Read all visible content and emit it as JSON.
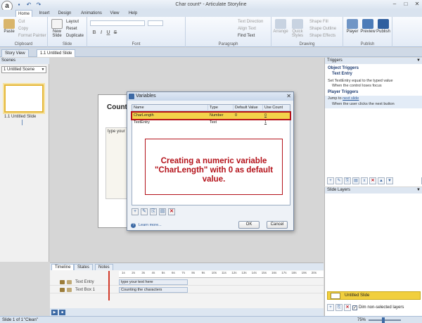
{
  "app": {
    "logo_letter": "a",
    "window_title": "Char count* - Articulate Storyline",
    "qat": [
      "save-icon",
      "undo-icon",
      "redo-icon"
    ]
  },
  "ribbon": {
    "tabs": [
      "Home",
      "Insert",
      "Design",
      "Animations",
      "View",
      "Help"
    ],
    "active_tab": "Home",
    "clipboard": {
      "label": "Clipboard",
      "paste": "Paste",
      "cut": "Cut",
      "copy": "Copy",
      "format_painter": "Format Painter"
    },
    "slide": {
      "label": "Slide",
      "new_slide": "New Slide",
      "layout": "Layout",
      "reset": "Reset",
      "duplicate": "Duplicate"
    },
    "font": {
      "label": "Font",
      "bold": "B",
      "italic": "I",
      "underline": "U",
      "strikethrough": "S"
    },
    "paragraph": {
      "label": "Paragraph",
      "text_direction": "Text Direction",
      "align_text": "Align Text",
      "find_text": "Find Text"
    },
    "drawing": {
      "label": "Drawing",
      "arrange": "Arrange",
      "quick_styles": "Quick Styles",
      "shape_fill": "Shape Fill",
      "shape_outline": "Shape Outline",
      "shape_effects": "Shape Effects"
    },
    "publish": {
      "label": "Publish",
      "player": "Player",
      "preview": "Preview",
      "publish": "Publish"
    }
  },
  "doc_tabs": [
    "Story View",
    "1.1 Untitled Slide"
  ],
  "scenes": {
    "header": "Scenes",
    "selected": "1 Untitled Scene",
    "slide_label": "1.1 Untitled Slide"
  },
  "stage": {
    "title": "Counting",
    "textbox": "type your"
  },
  "variables_dialog": {
    "title": "Variables",
    "columns": [
      "Name",
      "Type",
      "Default Value",
      "Use Count"
    ],
    "rows": [
      {
        "name": "CharLength",
        "type": "Number",
        "default": "0",
        "use_count": "0"
      },
      {
        "name": "TextEntry",
        "type": "Text",
        "default": "",
        "use_count": "1"
      }
    ],
    "callout": "Creating a numeric variable \"CharLength\" with 0 as default value.",
    "learn_more": "Learn more...",
    "ok": "OK",
    "cancel": "Cancel"
  },
  "triggers": {
    "header": "Triggers",
    "object_triggers": "Object Triggers",
    "object_name": "Text Entry",
    "trigger1": "Set TextEntry equal to the typed value",
    "trigger1_when": "When the control loses focus",
    "player_triggers": "Player Triggers",
    "trigger2_prefix": "Jump to",
    "trigger2_link": "next slide",
    "trigger2_when": "When the user clicks the next button"
  },
  "layers": {
    "header": "Slide Layers",
    "base_layer": "Untitled Slide",
    "dim_label": "Dim non-selected layers",
    "dim_checked": true
  },
  "timeline": {
    "tabs": [
      "Timeline",
      "States",
      "Notes"
    ],
    "ticks": [
      "1s",
      "2s",
      "3s",
      "4s",
      "5s",
      "6s",
      "7s",
      "8s",
      "9s",
      "10s",
      "11s",
      "12s",
      "13s",
      "14s",
      "15s",
      "16s",
      "17s",
      "18s",
      "19s",
      "20s"
    ],
    "rows": [
      {
        "name": "Text Entry",
        "bar": "type your text here"
      },
      {
        "name": "Text Box 1",
        "bar": "Counting the characters"
      }
    ]
  },
  "status": {
    "slide": "Slide 1 of 1",
    "theme": "\"Clean\"",
    "zoom": "75%"
  },
  "colors": {
    "highlight_row": "#f3d24a",
    "callout_red": "#b4121a",
    "ribbon_blue": "#d9e3ef"
  }
}
